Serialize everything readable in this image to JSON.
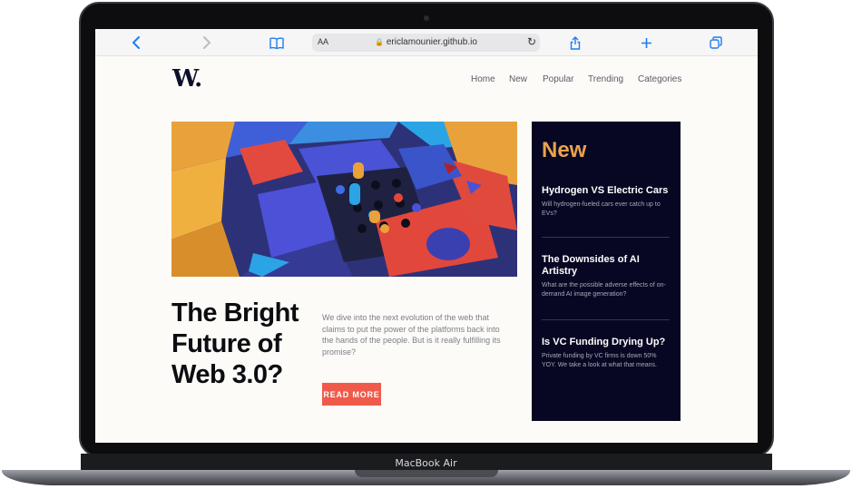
{
  "device": {
    "label": "MacBook Air"
  },
  "browser": {
    "address_prefix": "AA",
    "url": "ericlamounier.github.io",
    "icons": [
      "back-icon",
      "forward-icon",
      "bookmarks-icon",
      "lock-icon",
      "reload-icon",
      "share-icon",
      "new-tab-icon",
      "tabs-icon"
    ]
  },
  "site": {
    "logo": "W.",
    "nav": [
      "Home",
      "New",
      "Popular",
      "Trending",
      "Categories"
    ]
  },
  "hero": {
    "headline": "The Bright Future of Web 3.0?",
    "blurb": "We dive into the next evolution of the web that claims to put the power of the platforms back into the hands of the people. But is it really fulfilling its promise?",
    "cta": "READ MORE"
  },
  "new_section": {
    "title": "New",
    "items": [
      {
        "title": "Hydrogen VS Electric Cars",
        "desc": "Will hydrogen-fueled cars ever catch up to EVs?"
      },
      {
        "title": "The Downsides of AI Artistry",
        "desc": "What are the possible adverse effects of on-demand AI image generation?"
      },
      {
        "title": "Is VC Funding Drying Up?",
        "desc": "Private funding by VC firms is down 50% YOY. We take a look at what that means."
      }
    ]
  },
  "colors": {
    "accent": "#f05a4a",
    "new_title": "#e9a24c",
    "sidebar_bg": "#070723",
    "link_blue": "#1e7cf0"
  }
}
